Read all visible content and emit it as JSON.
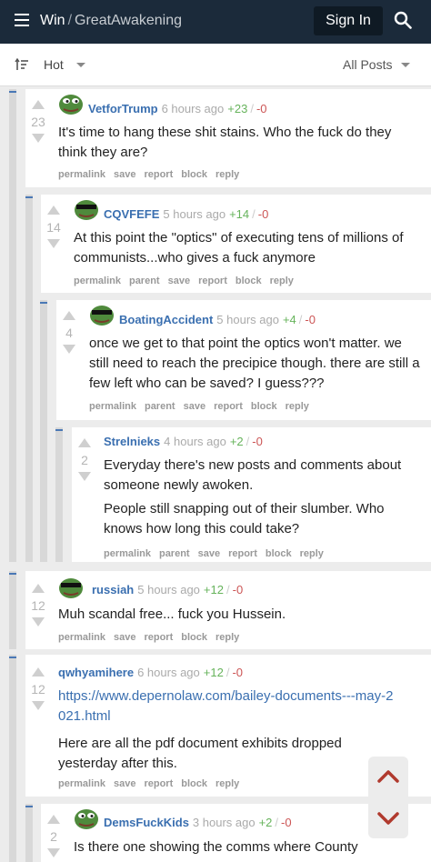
{
  "header": {
    "site": "Win",
    "separator": "/",
    "community": "GreatAwakening",
    "signin_label": "Sign In"
  },
  "filter": {
    "sort_label": "Hot",
    "scope_label": "All Posts"
  },
  "comments": [
    {
      "author": "VetforTrump",
      "time": "6 hours ago",
      "plus": "+23",
      "minus": "-0",
      "score": "23",
      "paragraphs": [
        "It's time to hang these shit stains. Who the fuck do they think they are?"
      ],
      "actions": [
        "permalink",
        "save",
        "report",
        "block",
        "reply"
      ]
    },
    {
      "author": "CQVFEFE",
      "time": "5 hours ago",
      "plus": "+14",
      "minus": "-0",
      "score": "14",
      "paragraphs": [
        "At this point the \"optics\" of executing tens of millions of communists...who gives a fuck anymore"
      ],
      "actions": [
        "permalink",
        "parent",
        "save",
        "report",
        "block",
        "reply"
      ]
    },
    {
      "author": "BoatingAccident",
      "time": "5 hours ago",
      "plus": "+4",
      "minus": "-0",
      "score": "4",
      "paragraphs": [
        "once we get to that point the optics won't matter. we still need to reach the precipice though. there are still a few left who can be saved? I guess???"
      ],
      "actions": [
        "permalink",
        "parent",
        "save",
        "report",
        "block",
        "reply"
      ]
    },
    {
      "author": "Strelnieks",
      "time": "4 hours ago",
      "plus": "+2",
      "minus": "-0",
      "score": "2",
      "paragraphs": [
        "Everyday there's new posts and comments about someone newly awoken.",
        "People still snapping out of their slumber. Who knows how long this could take?"
      ],
      "actions": [
        "permalink",
        "parent",
        "save",
        "report",
        "block",
        "reply"
      ]
    },
    {
      "author": "russiah",
      "time": "5 hours ago",
      "plus": "+12",
      "minus": "-0",
      "score": "12",
      "paragraphs": [
        "Muh scandal free... fuck you Hussein."
      ],
      "actions": [
        "permalink",
        "save",
        "report",
        "block",
        "reply"
      ]
    },
    {
      "author": "qwhyamihere",
      "time": "6 hours ago",
      "plus": "+12",
      "minus": "-0",
      "score": "12",
      "link": "https://www.depernolaw.com/bailey-documents---may-2021.html",
      "paragraphs": [
        "Here are all the pdf document exhibits dropped yesterday after this."
      ],
      "actions": [
        "permalink",
        "save",
        "report",
        "block",
        "reply"
      ]
    },
    {
      "author": "DemsFuckKids",
      "time": "3 hours ago",
      "plus": "+2",
      "minus": "-0",
      "score": "2",
      "paragraphs": [
        "Is there one showing the comms where County"
      ],
      "actions": []
    }
  ],
  "colors": {
    "topbar": "#1b2a3a",
    "link": "#3a6fb0",
    "upvote": "#66b35b",
    "downvote": "#cc5555",
    "nav_arrow": "#b03a2e"
  },
  "icons": [
    "menu-icon",
    "search-icon",
    "sort-icon",
    "upvote-arrow-icon",
    "downvote-arrow-icon",
    "pepe-avatar-icon",
    "chevron-up-icon",
    "chevron-down-icon"
  ]
}
